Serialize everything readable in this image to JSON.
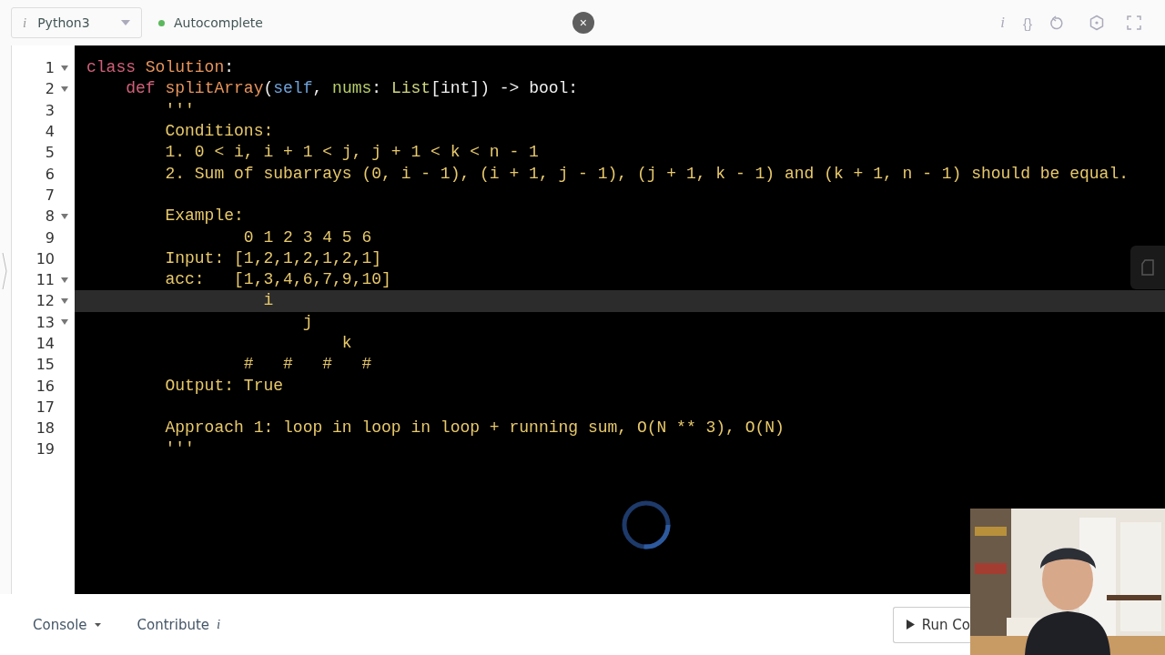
{
  "toolbar": {
    "language": "Python3",
    "language_info": "i",
    "autocomplete": {
      "label": "Autocomplete",
      "on": true
    },
    "close": "×",
    "actions": [
      "i",
      "{}"
    ]
  },
  "editor": {
    "lines": [
      {
        "number": "1",
        "foldable": true,
        "active": false,
        "tokens": [
          {
            "kind": "keyword",
            "text": "class "
          },
          {
            "kind": "name",
            "text": "Solution"
          },
          {
            "kind": "plain",
            "text": ":"
          }
        ]
      },
      {
        "number": "2",
        "foldable": true,
        "active": false,
        "tokens": [
          {
            "kind": "keyword",
            "text": "    def "
          },
          {
            "kind": "name",
            "text": "splitArray"
          },
          {
            "kind": "plain",
            "text": "("
          },
          {
            "kind": "self",
            "text": "self"
          },
          {
            "kind": "plain",
            "text": ", "
          },
          {
            "kind": "param",
            "text": "nums"
          },
          {
            "kind": "plain",
            "text": ": "
          },
          {
            "kind": "type",
            "text": "List"
          },
          {
            "kind": "plain",
            "text": "[int]) -> bool:"
          }
        ]
      },
      {
        "number": "3",
        "foldable": false,
        "active": false,
        "tokens": [
          {
            "kind": "string",
            "text": "        '''"
          }
        ]
      },
      {
        "number": "4",
        "foldable": false,
        "active": false,
        "tokens": [
          {
            "kind": "string",
            "text": "        Conditions:"
          }
        ]
      },
      {
        "number": "5",
        "foldable": false,
        "active": false,
        "tokens": [
          {
            "kind": "string",
            "text": "        1. 0 < i, i + 1 < j, j + 1 < k < n - 1"
          }
        ]
      },
      {
        "number": "6",
        "foldable": false,
        "active": false,
        "tokens": [
          {
            "kind": "string",
            "text": "        2. Sum of subarrays (0, i - 1), (i + 1, j - 1), (j + 1, k - 1) and (k + 1, n - 1) should be equal."
          }
        ]
      },
      {
        "number": "7",
        "foldable": false,
        "active": false
      },
      {
        "number": "8",
        "foldable": true,
        "active": false,
        "tokens": [
          {
            "kind": "string",
            "text": "        Example:"
          }
        ]
      },
      {
        "number": "9",
        "foldable": false,
        "active": false,
        "tokens": [
          {
            "kind": "string",
            "text": "                0 1 2 3 4 5 6"
          }
        ]
      },
      {
        "number": "10",
        "foldable": false,
        "active": false,
        "tokens": [
          {
            "kind": "string",
            "text": "        Input: [1,2,1,2,1,2,1]"
          }
        ]
      },
      {
        "number": "11",
        "foldable": true,
        "active": false,
        "tokens": [
          {
            "kind": "string",
            "text": "        acc:   [1,3,4,6,7,9,10]"
          }
        ]
      },
      {
        "number": "12",
        "foldable": true,
        "active": true,
        "tokens": [
          {
            "kind": "string",
            "text": "                  i"
          }
        ]
      },
      {
        "number": "13",
        "foldable": true,
        "active": false,
        "tokens": [
          {
            "kind": "string",
            "text": "                      j"
          }
        ]
      },
      {
        "number": "14",
        "foldable": false,
        "active": false,
        "tokens": [
          {
            "kind": "string",
            "text": "                          k"
          }
        ]
      },
      {
        "number": "15",
        "foldable": false,
        "active": false,
        "tokens": [
          {
            "kind": "string",
            "text": "                #   #   #   #"
          }
        ]
      },
      {
        "number": "16",
        "foldable": false,
        "active": false,
        "tokens": [
          {
            "kind": "string",
            "text": "        Output: True"
          }
        ]
      },
      {
        "number": "17",
        "foldable": false,
        "active": false
      },
      {
        "number": "18",
        "foldable": false,
        "active": false,
        "tokens": [
          {
            "kind": "string",
            "text": "        Approach 1: loop in loop in loop + running sum, O(N ** 3), O(N)"
          }
        ]
      },
      {
        "number": "19",
        "foldable": false,
        "active": false,
        "tokens": [
          {
            "kind": "string",
            "text": "        '''"
          }
        ]
      }
    ]
  },
  "footer": {
    "console": "Console",
    "contribute": "Contribute",
    "contribute_info": "i",
    "run": "Run Co"
  }
}
